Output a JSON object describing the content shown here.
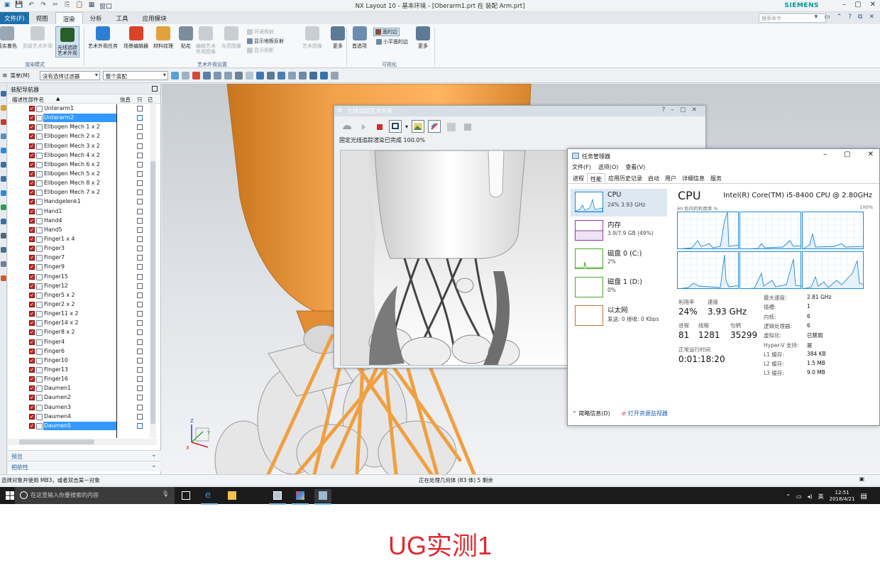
{
  "window": {
    "title": "NX Layout 10 - 基本环境 - [Oberarm1.prt 在 装配 Arm.prt]",
    "quick_access": [
      "save",
      "undo",
      "redo",
      "cut",
      "copy",
      "paste",
      "screenshot",
      "window"
    ],
    "window_menu_label": "窗口",
    "brand": "SIEMENS"
  },
  "menubar": {
    "file": "文件(F)",
    "tabs": [
      "视图",
      "渲染",
      "分析",
      "工具",
      "应用模块"
    ],
    "active_tab": "渲染",
    "command_search_placeholder": "搜索命令"
  },
  "ribbon": {
    "buttons": [
      {
        "label": "真实着色",
        "color": "#9aa7b4"
      },
      {
        "label": "高级艺术外观",
        "color": "#c9ced3"
      },
      {
        "label": "光线追踪\n艺术外观",
        "color": "#2b5f2a"
      },
      {
        "label": "艺术外观任务",
        "color": "#2d7fd3"
      },
      {
        "label": "场景编辑器",
        "color": "#d9432a"
      },
      {
        "label": "材料纹理",
        "color": "#e0a33c"
      },
      {
        "label": "贴花",
        "color": "#7c8e9e"
      },
      {
        "label": "编辑艺术\n外观图像",
        "color": "#c9ced3"
      },
      {
        "label": "光亮图像",
        "color": "#c9ced3"
      },
      {
        "label": "艺术图像",
        "color": "#c9ced3"
      },
      {
        "label": "更多",
        "color": "#5d7a96"
      },
      {
        "label": "首选项",
        "color": "#6b8bb0"
      },
      {
        "label": "更多",
        "color": "#5d7a96"
      }
    ],
    "small_items": [
      "环境照射",
      "显示地板反射",
      "显示阴影",
      "面的边",
      "小平面的边"
    ],
    "groups": [
      "渲染模式",
      "艺术外观设置",
      "可视化"
    ]
  },
  "toolbar": {
    "menu_label": "菜单(M)",
    "filter_value": "没有选择过滤器",
    "scope_value": "整个装配"
  },
  "navigator": {
    "title": "装配导航器",
    "columns": [
      "描述性部件名",
      "信息",
      "只",
      "已"
    ],
    "items": [
      "Unterarm1",
      "Unterarm2",
      "Ellbogen Mech 1 x 2",
      "Ellbogen Mech 2 x 2",
      "Ellbogen Mech 3 x 2",
      "Ellbogen Mech 4 x 2",
      "Ellbogen Mech 6 x 2",
      "Ellbogen Mech 5 x 2",
      "Ellbogen Mech 8 x 2",
      "Ellbogen Mech 7 x 2",
      "Handgelenk1",
      "Hand1",
      "Hand4",
      "Hand5",
      "Finger1 x 4",
      "Finger3",
      "Finger7",
      "Finger9",
      "Finger15",
      "Finger12",
      "Finger5 x 2",
      "Finger2 x 2",
      "Finger11 x 2",
      "Finger14 x 2",
      "Finger8 x 2",
      "Finger4",
      "Finger6",
      "Finger10",
      "Finger13",
      "Finger16",
      "Daumen1",
      "Daumen2",
      "Daumen3",
      "Daumen4",
      "Daumen5"
    ],
    "selected": [
      "Unterarm2",
      "Daumen5"
    ],
    "panels": [
      "预览",
      "相依性"
    ]
  },
  "status": {
    "left": "选择对象并使用 MB3，或者双击某一对象",
    "center": "正在处理几何体 (83 体) 5 剩余"
  },
  "raytrace": {
    "title": "光线追踪艺术外观",
    "status": "固定光线追踪渲染已完成 100.0%"
  },
  "taskmgr": {
    "title": "任务管理器",
    "menu": [
      "文件(F)",
      "选项(O)",
      "查看(V)"
    ],
    "tabs": [
      "进程",
      "性能",
      "应用历史记录",
      "启动",
      "用户",
      "详细信息",
      "服务"
    ],
    "active_tab": "性能",
    "resources": [
      {
        "name": "CPU",
        "value": "24%  3.93 GHz",
        "color": "#1f8ad8"
      },
      {
        "name": "内存",
        "value": "3.9/7.9 GB (49%)",
        "color": "#8b3ba8"
      },
      {
        "name": "磁盘 0 (C:)",
        "value": "2%",
        "color": "#4da72f"
      },
      {
        "name": "磁盘 1 (D:)",
        "value": "0%",
        "color": "#4da72f"
      },
      {
        "name": "以太网",
        "value": "发送: 0 接收: 0 Kbps",
        "color": "#b8753a"
      }
    ],
    "cpu_label": "CPU",
    "cpu_model": "Intel(R) Core(TM) i5-8400 CPU @ 2.80GHz",
    "util_caption": "60 秒内的利用率 %",
    "util_max": "100%",
    "utilization_label": "利用率",
    "utilization": "24%",
    "speed_label": "速度",
    "speed": "3.93 GHz",
    "processes_label": "进程",
    "processes": "81",
    "threads_label": "线程",
    "threads": "1281",
    "handles_label": "句柄",
    "handles": "35299",
    "uptime_label": "正常运行时间",
    "uptime": "0:01:18:20",
    "specs": [
      {
        "k": "最大速度:",
        "v": "2.81 GHz"
      },
      {
        "k": "插槽:",
        "v": "1"
      },
      {
        "k": "内核:",
        "v": "6"
      },
      {
        "k": "逻辑处理器:",
        "v": "6"
      },
      {
        "k": "虚拟化:",
        "v": "已禁用"
      },
      {
        "k": "Hyper-V 支持:",
        "v": "是"
      },
      {
        "k": "L1 缓存:",
        "v": "384 KB"
      },
      {
        "k": "L2 缓存:",
        "v": "1.5 MB"
      },
      {
        "k": "L3 缓存:",
        "v": "9.0 MB"
      }
    ],
    "fewer_details": "简略信息(D)",
    "open_monitor": "打开资源监视器"
  },
  "taskbar": {
    "search_placeholder": "在这里输入你要搜索的内容",
    "ime": "英",
    "time": "12:51",
    "date": "2018/4/21"
  },
  "caption": "UG实测1",
  "colors": {
    "accent": "#1f6fa8",
    "model_orange": "#f0a040",
    "selection": "#3399ff",
    "caption_red": "#e0282f"
  }
}
